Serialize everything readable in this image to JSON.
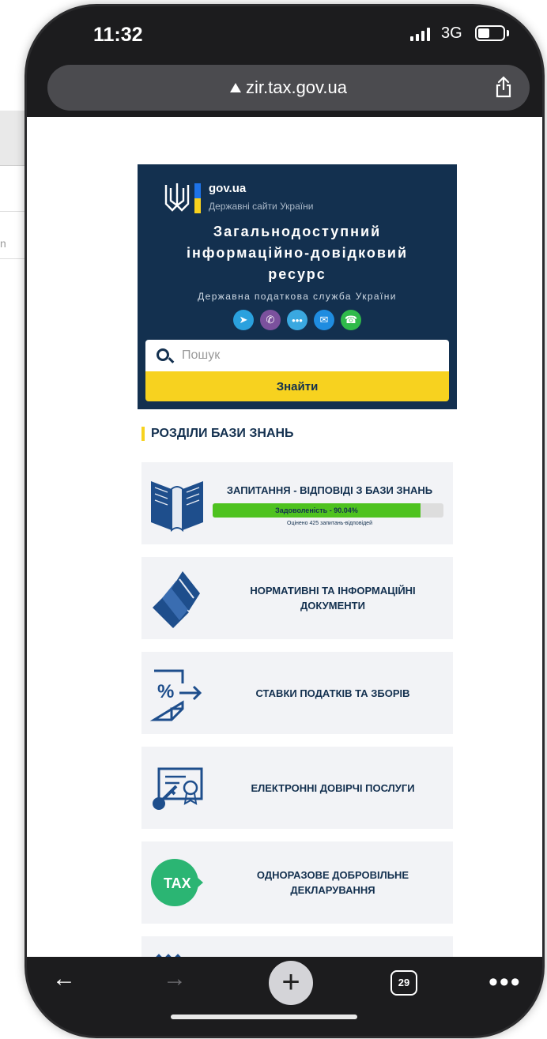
{
  "status": {
    "time": "11:32",
    "network": "3G"
  },
  "browser": {
    "url": "zir.tax.gov.ua",
    "tab_count": "29"
  },
  "hero": {
    "brand": "gov.ua",
    "brand_sub": "Державні сайти України",
    "title_l1": "Загальнодоступний",
    "title_l2": "інформаційно-довідковий",
    "title_l3": "ресурс",
    "agency": "Державна податкова служба України",
    "socials": [
      {
        "name": "telegram-icon",
        "color": "#2aa1de"
      },
      {
        "name": "viber-icon",
        "color": "#7b519d"
      },
      {
        "name": "chat-icon",
        "color": "#3aa8e0"
      },
      {
        "name": "mail-icon",
        "color": "#1f8ce0"
      },
      {
        "name": "phone-icon",
        "color": "#2fba4a"
      }
    ],
    "search_placeholder": "Пошук",
    "search_button": "Знайти"
  },
  "sections": {
    "heading": "РОЗДІЛИ БАЗИ ЗНАНЬ",
    "qa": {
      "title": "ЗАПИТАННЯ - ВІДПОВІДІ З БАЗИ ЗНАНЬ",
      "satisfaction_label": "Задоволеність - 90.04%",
      "satisfaction_value": 90.04,
      "rated": "Оцінено 425 запитань-відповідей"
    },
    "docs": "НОРМАТИВНІ ТА ІНФОРМАЦІЙНІ ДОКУМЕНТИ",
    "rates": "СТАВКИ ПОДАТКІВ ТА ЗБОРІВ",
    "trust": "ЕЛЕКТРОННІ ДОВІРЧІ ПОСЛУГИ",
    "declaration": "ОДНОРАЗОВЕ ДОБРОВІЛЬНЕ ДЕКЛАРУВАННЯ",
    "tax_badge": "TAX"
  },
  "colors": {
    "navy": "#13304f",
    "yellow": "#f7d21f",
    "card": "#f2f3f6",
    "green": "#4ec21f"
  }
}
